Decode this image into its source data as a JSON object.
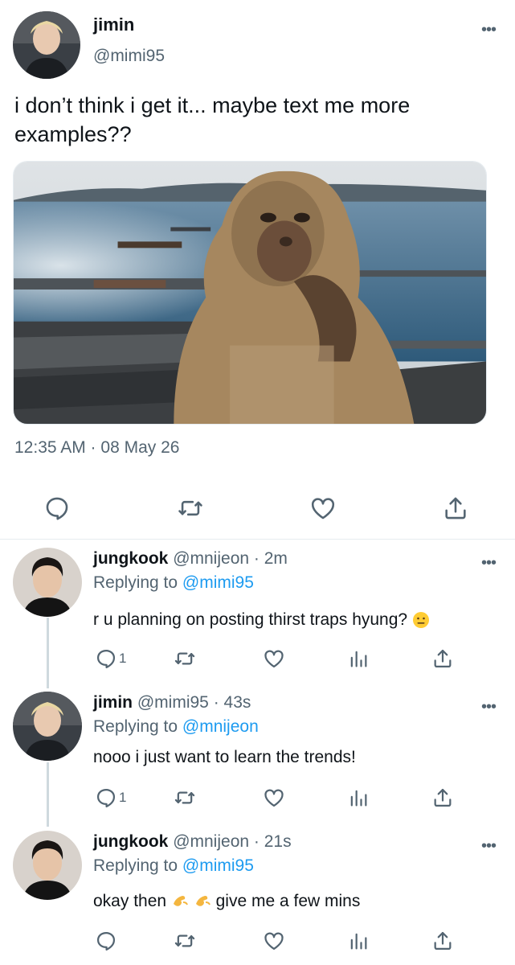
{
  "main_tweet": {
    "name": "jimin",
    "handle": "@mimi95",
    "text": "i don’t think i get it... maybe text me more examples??",
    "timestamp": "12:35 AM · 08 May 26",
    "avatar_icon": "avatar-photo",
    "more_icon": "more-horizontal-icon",
    "photo_subject": "thinking-monkey-photo"
  },
  "replies": [
    {
      "name": "jungkook",
      "handle": "@mnijeon · 2m",
      "replying_prefix": "Replying to",
      "replying_to": "@mimi95",
      "text": "r u planning on posting thirst traps hyung?",
      "text_suffix_emoji": "grimace-face-emoji",
      "reply_count": "1"
    },
    {
      "name": "jimin",
      "handle": "@mimi95 · 43s",
      "replying_prefix": "Replying to",
      "replying_to": "@mnijeon",
      "text": "nooo i just want to learn the trends!",
      "reply_count": "1"
    },
    {
      "name": "jungkook",
      "handle": "@mnijeon · 21s",
      "replying_prefix": "Replying to",
      "replying_to": "@mimi95",
      "text_before": "okay then",
      "text_after": "give me a few mins",
      "inline_emojis": [
        "salute-hand-emoji",
        "salute-hand-emoji"
      ],
      "reply_count": ""
    }
  ],
  "colors": {
    "link": "#1d9bf0",
    "secondary_text": "#536471",
    "primary_text": "#0f1419",
    "divider": "#e6ecf0"
  }
}
